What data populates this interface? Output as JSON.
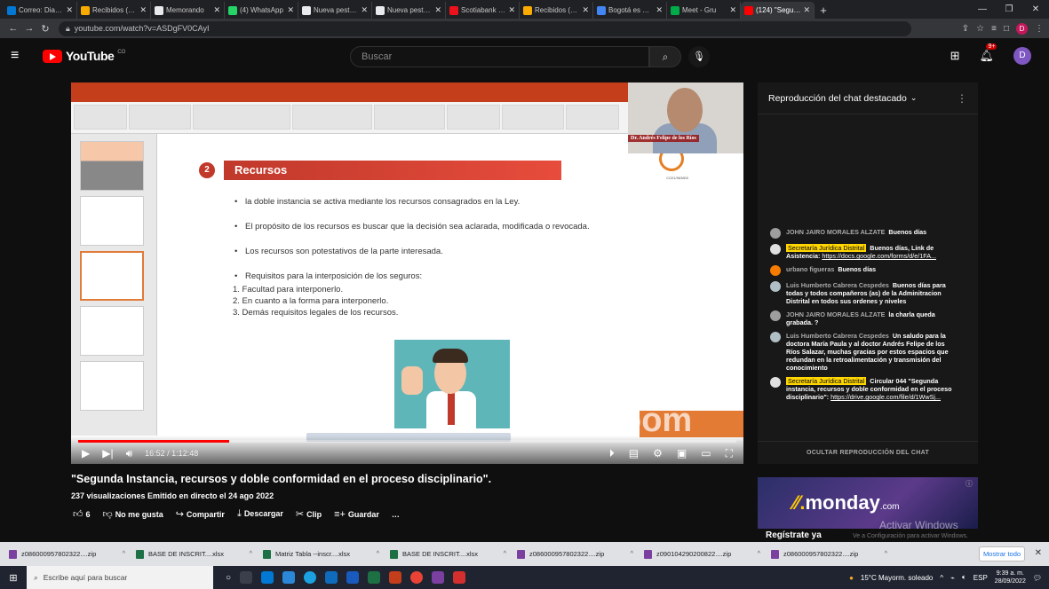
{
  "browser": {
    "tabs": [
      {
        "title": "Correo: Diana C",
        "color": "#0078d4"
      },
      {
        "title": "Recibidos (979)",
        "color": "#f9ab00"
      },
      {
        "title": "Memorando",
        "color": "#e8eaed"
      },
      {
        "title": "(4) WhatsApp",
        "color": "#25d366"
      },
      {
        "title": "Nueva pestaña",
        "color": "#e8eaed"
      },
      {
        "title": "Nueva pestaña",
        "color": "#e8eaed"
      },
      {
        "title": "Scotiabank Colo",
        "color": "#ec111a"
      },
      {
        "title": "Recibidos (979)",
        "color": "#f9ab00"
      },
      {
        "title": "Bogotá es TIC -",
        "color": "#4285f4"
      },
      {
        "title": "Meet - Gru",
        "color": "#00ac47"
      },
      {
        "title": "(124) \"Segundo",
        "color": "#ff0000"
      }
    ],
    "url": "youtube.com/watch?v=ASDgFV0CAyI",
    "profile_letter": "D"
  },
  "youtube": {
    "logo_text": "YouTube",
    "logo_suffix": "CO",
    "search_placeholder": "Buscar",
    "notif_count": "9+",
    "avatar_letter": "D"
  },
  "slide": {
    "number": "2",
    "title": "Recursos",
    "logo_caption": "CO21/963800",
    "bullets": [
      "la doble instancia se activa mediante los recursos consagrados en la Ley.",
      "El propósito de los recursos es buscar que la decisión sea aclarada, modificada o revocada.",
      "Los recursos son potestativos de la parte interesada.",
      "Requisitos para la interposición de los seguros:"
    ],
    "numbered": [
      "1.  Facultad para interponerlo.",
      "2.  En cuanto a la forma para interponerlo.",
      "3.  Demás requisitos legales de los recursos."
    ],
    "webcam_name": "Dr. Andrés Felipe de los Ríos",
    "zoom_watermark": "zoom"
  },
  "player": {
    "time": "16:52 / 1:12:48",
    "progress": 0.23
  },
  "chat": {
    "header": "Reproducción del chat destacado",
    "messages": [
      {
        "author": "JOHN JAIRO MORALES ALZATE",
        "text": "Buenos días",
        "highlight": false,
        "avatar": "#9e9e9e"
      },
      {
        "author": "Secretaría Jurídica Distrital",
        "text": "Buenos días, Link de Asistencia:",
        "link": "https://docs.google.com/forms/d/e/1FA...",
        "highlight": true,
        "avatar": "#e0e0e0"
      },
      {
        "author": "urbano figueras",
        "text": "Buenos días",
        "highlight": false,
        "avatar": "#f57c00"
      },
      {
        "author": "Luis Humberto Cabrera Cespedes",
        "text": "Buenos días para todas y todos compañeros (as) de la Adminitracion Distrital en todos sus ordenes y niveles",
        "highlight": false,
        "avatar": "#b0bec5"
      },
      {
        "author": "JOHN JAIRO MORALES ALZATE",
        "text": "la charla queda grabada. ?",
        "highlight": false,
        "avatar": "#9e9e9e"
      },
      {
        "author": "Luis Humberto Cabrera Cespedes",
        "text": "Un saludo para la doctora María Paula y al doctor Andrés Felipe de los Ríos Salazar, muchas gracias por estos espacios que redundan en la retroalimentación y transmisión del conocimiento",
        "highlight": false,
        "avatar": "#b0bec5"
      },
      {
        "author": "Secretaría Jurídica Distrital",
        "text": "Circular 044 \"Segunda instancia, recursos y doble conformidad en el proceso disciplinario\":",
        "link": "https://drive.google.com/file/d/1WwSj...",
        "highlight": true,
        "avatar": "#e0e0e0"
      }
    ],
    "footer": "OCULTAR REPRODUCCIÓN DEL CHAT"
  },
  "video": {
    "title": "\"Segunda Instancia, recursos y doble conformidad en el proceso disciplinario\".",
    "meta": "237 visualizaciones  Emitido en directo el 24 ago 2022",
    "likes": "6",
    "actions": [
      "No me gusta",
      "Compartir",
      "Descargar",
      "Clip",
      "Guardar"
    ]
  },
  "ad": {
    "brand": "monday",
    "suffix": ".com",
    "register": "Regístrate ya"
  },
  "watermark": {
    "line1": "Activar Windows",
    "line2": "Ve a Configuración para activar Windows."
  },
  "downloads": {
    "items": [
      {
        "name": "z086000957802322....zip",
        "color": "#7b3fa0"
      },
      {
        "name": "BASE DE INSCRIT....xlsx",
        "color": "#1d7044"
      },
      {
        "name": "Matriz Tabla --inscr....xlsx",
        "color": "#1d7044"
      },
      {
        "name": "BASE DE INSCRIT....xlsx",
        "color": "#1d7044"
      },
      {
        "name": "z086000957802322....zip",
        "color": "#7b3fa0"
      },
      {
        "name": "z090104290200822....zip",
        "color": "#7b3fa0"
      },
      {
        "name": "z086000957802322....zip",
        "color": "#7b3fa0"
      }
    ],
    "show_all": "Mostrar todo"
  },
  "taskbar": {
    "search": "Escribe aquí para buscar",
    "weather": "15°C  Mayorm. soleado",
    "lang": "ESP",
    "time": "9:39 a. m.",
    "date": "28/09/2022"
  }
}
